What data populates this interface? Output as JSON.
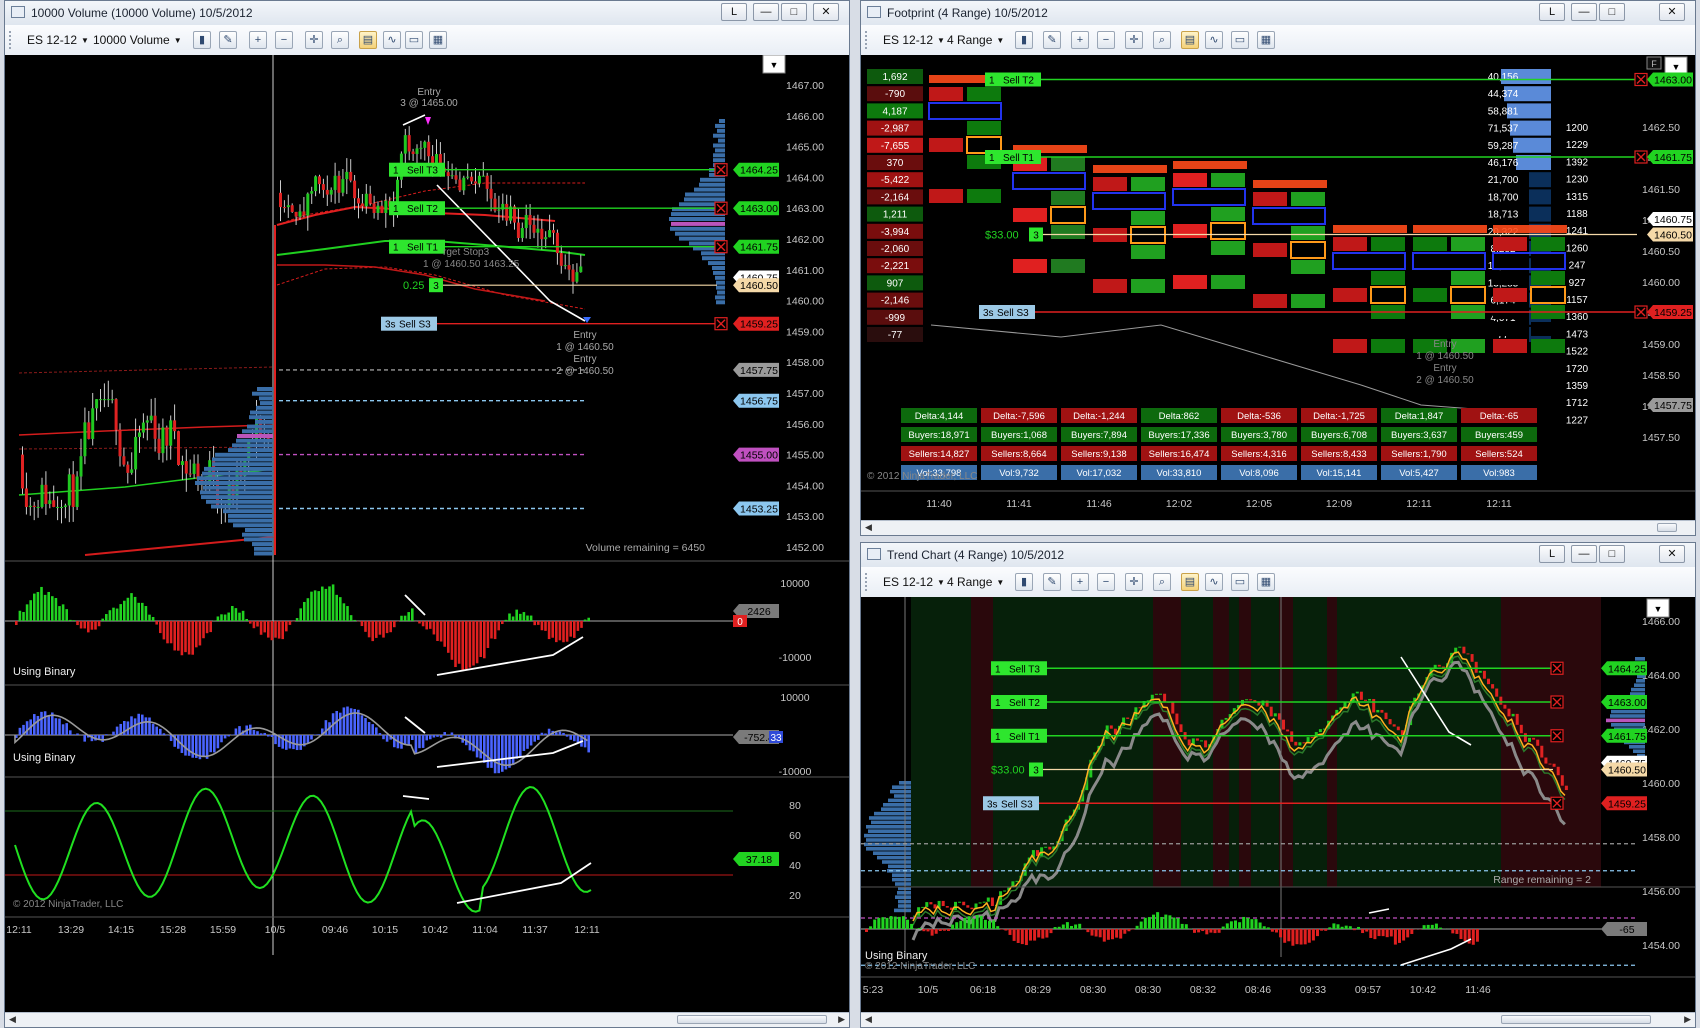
{
  "windows": {
    "volume": {
      "title": "10000 Volume (10000 Volume)  10/5/2012",
      "instrument": "ES 12-12",
      "period": "10000 Volume",
      "price_axis": [
        "1467.00",
        "1466.00",
        "1465.00",
        "1464.00",
        "1463.00",
        "1462.00",
        "1461.00",
        "1460.00",
        "1459.00",
        "1458.00",
        "1457.00",
        "1456.00",
        "1455.00",
        "1454.00",
        "1453.00",
        "1452.00"
      ],
      "price_tags": [
        {
          "label": "1464.25",
          "color": "#21d321"
        },
        {
          "label": "1463.00",
          "color": "#21d321"
        },
        {
          "label": "1461.75",
          "color": "#21d321"
        },
        {
          "label": "1460.75",
          "color": "#ffffff"
        },
        {
          "label": "1460.50",
          "color": "#f5d9a8"
        },
        {
          "label": "1459.25",
          "color": "#e02020"
        },
        {
          "label": "1457.75",
          "color": "#9a9a9a"
        },
        {
          "label": "1456.75",
          "color": "#8cc7ef"
        },
        {
          "label": "1455.00",
          "color": "#c050c0"
        },
        {
          "label": "1453.25",
          "color": "#8cc7ef"
        }
      ],
      "orders": [
        {
          "qty": "1",
          "label": "Sell T3"
        },
        {
          "qty": "1",
          "label": "Sell T2"
        },
        {
          "qty": "1",
          "label": "Sell T1"
        },
        {
          "qty": "3s",
          "label": "Sell S3"
        }
      ],
      "pnl_label": "0.25",
      "pnl_qty": "3",
      "entry_top": [
        "Entry",
        "3 @ 1465.00"
      ],
      "entry_bottom": [
        "Entry",
        "1 @ 1460.50",
        "Entry",
        "2 @ 1460.50"
      ],
      "target_text": "rget  Stop3",
      "target_text2": "1 @ 1460.50  1463.25",
      "volume_remaining": "Volume remaining = 6450",
      "ind1": {
        "label": "Using Binary",
        "axis": [
          "10000",
          "-10000"
        ],
        "tag": "2426",
        "tag2": "0"
      },
      "ind2": {
        "label": "Using Binary",
        "axis": [
          "10000",
          "-10000"
        ],
        "tag": "-752.4",
        "tag2": "33"
      },
      "ind3": {
        "axis": [
          "80",
          "60",
          "40",
          "20"
        ],
        "tag": "37.18"
      },
      "copyright": "© 2012 NinjaTrader, LLC",
      "time_axis": [
        "12:11",
        "13:29",
        "14:15",
        "15:28",
        "15:59",
        "10/5",
        "09:46",
        "10:15",
        "10:42",
        "11:04",
        "11:37",
        "12:11"
      ]
    },
    "footprint": {
      "title": "Footprint (4 Range)  10/5/2012",
      "instrument": "ES 12-12",
      "period": "4 Range",
      "price_axis": [
        "1462.50",
        "1462.00",
        "1461.50",
        "1461.00",
        "1460.50",
        "1460.00",
        "1459.50",
        "1459.00",
        "1458.50",
        "1458.00",
        "1457.50"
      ],
      "price_tags": [
        {
          "label": "1463.00",
          "color": "#21d321"
        },
        {
          "label": "1461.75",
          "color": "#21d321"
        },
        {
          "label": "1460.75",
          "color": "#ffffff"
        },
        {
          "label": "1460.50",
          "color": "#f5d9a8"
        },
        {
          "label": "1459.25",
          "color": "#e02020"
        },
        {
          "label": "1457.75",
          "color": "#9a9a9a"
        }
      ],
      "orders": [
        {
          "qty": "1",
          "label": "Sell T2"
        },
        {
          "qty": "1",
          "label": "Sell T1"
        },
        {
          "qty": "3s",
          "label": "Sell S3"
        }
      ],
      "pnl_label": "$33.00",
      "pnl_qty": "3",
      "left_deltas": [
        "1,692",
        "-790",
        "4,187",
        "-2,987",
        "-7,655",
        "370",
        "-5,422",
        "-2,164",
        "1,211",
        "-3,994",
        "-2,060",
        "-2,221",
        "907",
        "-2,146",
        "-999",
        "-77"
      ],
      "right_volumes": [
        "40,156",
        "44,374",
        "58,881",
        "71,537",
        "59,287",
        "46,176",
        "21,700",
        "18,700",
        "18,713",
        "20,322",
        "8,282",
        "12,028",
        "13,285",
        "6,174",
        "4,071",
        "77"
      ],
      "right_counts": [
        "1200",
        "1229",
        "1392",
        "1230",
        "1315",
        "1188",
        "1241",
        "1260",
        "247",
        "927",
        "1157",
        "1360",
        "1473",
        "1522",
        "1720",
        "1359",
        "1712",
        "1227"
      ],
      "summary": [
        {
          "delta": "Delta:4,144",
          "buyers": "Buyers:18,971",
          "sellers": "Sellers:14,827",
          "vol": "Vol:33,798"
        },
        {
          "delta": "Delta:-7,596",
          "buyers": "Buyers:1,068",
          "sellers": "Sellers:8,664",
          "vol": "Vol:9,732"
        },
        {
          "delta": "Delta:-1,244",
          "buyers": "Buyers:7,894",
          "sellers": "Sellers:9,138",
          "vol": "Vol:17,032"
        },
        {
          "delta": "Delta:862",
          "buyers": "Buyers:17,336",
          "sellers": "Sellers:16,474",
          "vol": "Vol:33,810"
        },
        {
          "delta": "Delta:-536",
          "buyers": "Buyers:3,780",
          "sellers": "Sellers:4,316",
          "vol": "Vol:8,096"
        },
        {
          "delta": "Delta:-1,725",
          "buyers": "Buyers:6,708",
          "sellers": "Sellers:8,433",
          "vol": "Vol:15,141"
        },
        {
          "delta": "Delta:1,847",
          "buyers": "Buyers:3,637",
          "sellers": "Sellers:1,790",
          "vol": "Vol:5,427"
        },
        {
          "delta": "Delta:-65",
          "buyers": "Buyers:459",
          "sellers": "Sellers:524",
          "vol": "Vol:983"
        }
      ],
      "time_axis": [
        "11:40",
        "11:41",
        "11:46",
        "12:02",
        "12:05",
        "12:09",
        "12:11",
        "12:11"
      ],
      "copyright": "© 2012 NinjaTrader, LLC",
      "entry_text": [
        "Entry",
        "1 @ 1460.50",
        "Entry",
        "2 @ 1460.50"
      ]
    },
    "trend": {
      "title": "Trend Chart (4 Range)  10/5/2012",
      "instrument": "ES 12-12",
      "period": "4 Range",
      "price_axis": [
        "1466.00",
        "1464.00",
        "1462.00",
        "1460.00",
        "1458.00",
        "1456.00",
        "1454.00"
      ],
      "price_tags": [
        {
          "label": "1464.25",
          "color": "#21d321"
        },
        {
          "label": "1463.00",
          "color": "#21d321"
        },
        {
          "label": "1461.75",
          "color": "#21d321"
        },
        {
          "label": "1460.75",
          "color": "#ffffff"
        },
        {
          "label": "1460.50",
          "color": "#f5d9a8"
        },
        {
          "label": "1459.25",
          "color": "#e02020"
        }
      ],
      "orders": [
        {
          "qty": "1",
          "label": "Sell T3"
        },
        {
          "qty": "1",
          "label": "Sell T2"
        },
        {
          "qty": "1",
          "label": "Sell T1"
        },
        {
          "qty": "3s",
          "label": "Sell S3"
        }
      ],
      "pnl_label": "$33.00",
      "pnl_qty": "3",
      "range_remaining": "Range remaining = 2",
      "ind": {
        "label": "Using Binary",
        "tag": "-65"
      },
      "copyright": "© 2012 NinjaTrader, LLC",
      "time_axis": [
        "5:23",
        "10/5",
        "06:18",
        "08:29",
        "08:30",
        "08:30",
        "08:32",
        "08:46",
        "09:33",
        "09:57",
        "10:42",
        "11:46"
      ]
    }
  }
}
